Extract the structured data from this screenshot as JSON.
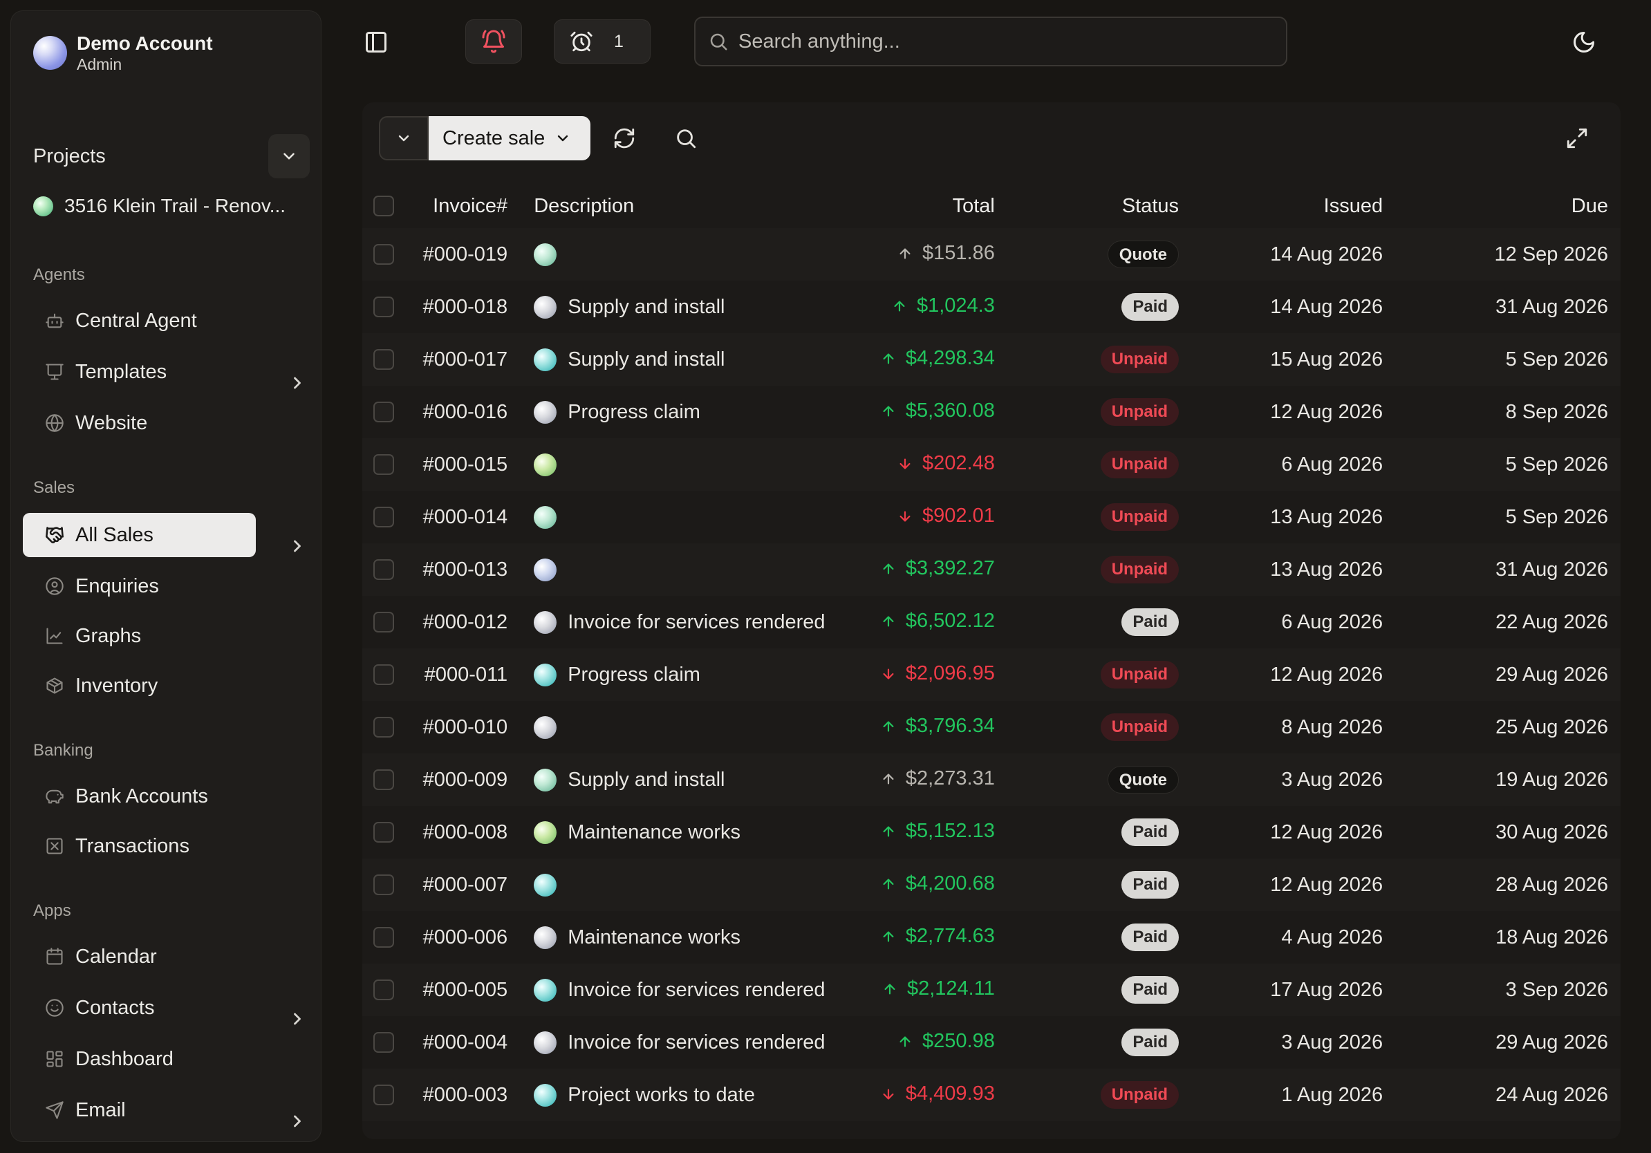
{
  "account": {
    "name": "Demo Account",
    "role": "Admin"
  },
  "projects": {
    "label": "Projects",
    "current": "3516 Klein Trail - Renov..."
  },
  "sidebar": {
    "agents_title": "Agents",
    "agents": [
      {
        "label": "Central Agent",
        "icon": "bot-icon"
      },
      {
        "label": "Templates",
        "icon": "presentation-icon"
      },
      {
        "label": "Website",
        "icon": "globe-icon"
      }
    ],
    "sales_title": "Sales",
    "sales": [
      {
        "label": "All Sales",
        "icon": "handshake-icon"
      },
      {
        "label": "Enquiries",
        "icon": "user-circle-icon"
      },
      {
        "label": "Graphs",
        "icon": "chart-icon"
      },
      {
        "label": "Inventory",
        "icon": "package-icon"
      }
    ],
    "banking_title": "Banking",
    "banking": [
      {
        "label": "Bank Accounts",
        "icon": "piggy-bank-icon"
      },
      {
        "label": "Transactions",
        "icon": "receipt-icon"
      }
    ],
    "apps_title": "Apps",
    "apps": [
      {
        "label": "Calendar",
        "icon": "calendar-icon"
      },
      {
        "label": "Contacts",
        "icon": "smile-icon"
      },
      {
        "label": "Dashboard",
        "icon": "dashboard-icon"
      },
      {
        "label": "Email",
        "icon": "send-icon"
      }
    ]
  },
  "topbar": {
    "alarm_count": "1",
    "search_placeholder": "Search anything..."
  },
  "toolbar": {
    "create_label": "Create sale"
  },
  "table": {
    "headers": {
      "invoice": "Invoice#",
      "description": "Description",
      "total": "Total",
      "status": "Status",
      "issued": "Issued",
      "due": "Due"
    },
    "rows": [
      {
        "invoice": "#000-019",
        "description": "",
        "total": "$151.86",
        "trend": "neutral",
        "status": "Quote",
        "issued": "14 Aug 2026",
        "due": "12 Sep 2026"
      },
      {
        "invoice": "#000-018",
        "description": "Supply and install",
        "total": "$1,024.3",
        "trend": "up",
        "status": "Paid",
        "issued": "14 Aug 2026",
        "due": "31 Aug 2026"
      },
      {
        "invoice": "#000-017",
        "description": "Supply and install",
        "total": "$4,298.34",
        "trend": "up",
        "status": "Unpaid",
        "issued": "15 Aug 2026",
        "due": "5 Sep 2026"
      },
      {
        "invoice": "#000-016",
        "description": "Progress claim",
        "total": "$5,360.08",
        "trend": "up",
        "status": "Unpaid",
        "issued": "12 Aug 2026",
        "due": "8 Sep 2026"
      },
      {
        "invoice": "#000-015",
        "description": "",
        "total": "$202.48",
        "trend": "down",
        "status": "Unpaid",
        "issued": "6 Aug 2026",
        "due": "5 Sep 2026"
      },
      {
        "invoice": "#000-014",
        "description": "",
        "total": "$902.01",
        "trend": "down",
        "status": "Unpaid",
        "issued": "13 Aug 2026",
        "due": "5 Sep 2026"
      },
      {
        "invoice": "#000-013",
        "description": "",
        "total": "$3,392.27",
        "trend": "up",
        "status": "Unpaid",
        "issued": "13 Aug 2026",
        "due": "31 Aug 2026"
      },
      {
        "invoice": "#000-012",
        "description": "Invoice for services rendered",
        "total": "$6,502.12",
        "trend": "up",
        "status": "Paid",
        "issued": "6 Aug 2026",
        "due": "22 Aug 2026"
      },
      {
        "invoice": "#000-011",
        "description": "Progress claim",
        "total": "$2,096.95",
        "trend": "down",
        "status": "Unpaid",
        "issued": "12 Aug 2026",
        "due": "29 Aug 2026"
      },
      {
        "invoice": "#000-010",
        "description": "",
        "total": "$3,796.34",
        "trend": "up",
        "status": "Unpaid",
        "issued": "8 Aug 2026",
        "due": "25 Aug 2026"
      },
      {
        "invoice": "#000-009",
        "description": "Supply and install",
        "total": "$2,273.31",
        "trend": "neutral",
        "status": "Quote",
        "issued": "3 Aug 2026",
        "due": "19 Aug 2026"
      },
      {
        "invoice": "#000-008",
        "description": "Maintenance works",
        "total": "$5,152.13",
        "trend": "up",
        "status": "Paid",
        "issued": "12 Aug 2026",
        "due": "30 Aug 2026"
      },
      {
        "invoice": "#000-007",
        "description": "",
        "total": "$4,200.68",
        "trend": "up",
        "status": "Paid",
        "issued": "12 Aug 2026",
        "due": "28 Aug 2026"
      },
      {
        "invoice": "#000-006",
        "description": "Maintenance works",
        "total": "$2,774.63",
        "trend": "up",
        "status": "Paid",
        "issued": "4 Aug 2026",
        "due": "18 Aug 2026"
      },
      {
        "invoice": "#000-005",
        "description": "Invoice for services rendered",
        "total": "$2,124.11",
        "trend": "up",
        "status": "Paid",
        "issued": "17 Aug 2026",
        "due": "3 Sep 2026"
      },
      {
        "invoice": "#000-004",
        "description": "Invoice for services rendered",
        "total": "$250.98",
        "trend": "up",
        "status": "Paid",
        "issued": "3 Aug 2026",
        "due": "29 Aug 2026"
      },
      {
        "invoice": "#000-003",
        "description": "Project works to date",
        "total": "$4,409.93",
        "trend": "down",
        "status": "Unpaid",
        "issued": "1 Aug 2026",
        "due": "24 Aug 2026"
      }
    ]
  },
  "colors": {
    "up": "#22c55e",
    "down": "#ef3b48",
    "accent_bell": "#f05260"
  }
}
